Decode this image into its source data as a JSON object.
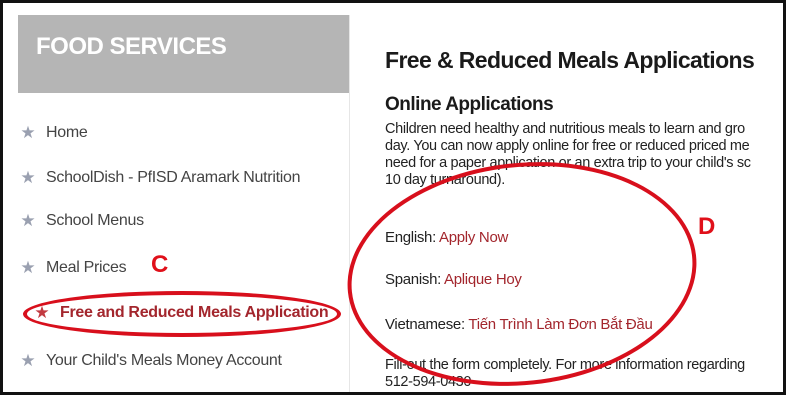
{
  "sidebar": {
    "title": "FOOD SERVICES",
    "items": [
      {
        "label": "Home",
        "icon": "star-icon"
      },
      {
        "label": "SchoolDish - PfISD Aramark Nutrition",
        "icon": "star-icon"
      },
      {
        "label": "School Menus",
        "icon": "star-icon"
      },
      {
        "label": "Meal Prices",
        "icon": "star-icon"
      },
      {
        "label": "Free and Reduced Meals Application",
        "icon": "star-icon",
        "active": true
      },
      {
        "label": "Your Child's Meals Money Account",
        "icon": "star-icon"
      }
    ]
  },
  "main": {
    "title": "Free & Reduced Meals Applications",
    "section_title": "Online Applications",
    "intro_lines": [
      "Children need healthy and nutritious meals to learn and gro",
      "day. You can now apply online for free or reduced priced me",
      "need for a paper application or an extra trip to your child's sc",
      "10 day turnaround)."
    ],
    "languages": [
      {
        "label": "English:",
        "link": "Apply Now"
      },
      {
        "label": "Spanish:",
        "link": "Aplique Hoy"
      },
      {
        "label": "Vietnamese:",
        "link": "Tiến Trình Làm Đơn Bắt Đầu"
      }
    ],
    "footer_lines": [
      "Fill-out the form completely. For more information regarding",
      "512-594-0430"
    ]
  },
  "annotations": {
    "c_label": "C",
    "d_label": "D",
    "color": "#d80f1c"
  },
  "colors": {
    "header_bg": "#b5b5b5",
    "link": "#a3262d",
    "star": "#9aa0b0"
  }
}
